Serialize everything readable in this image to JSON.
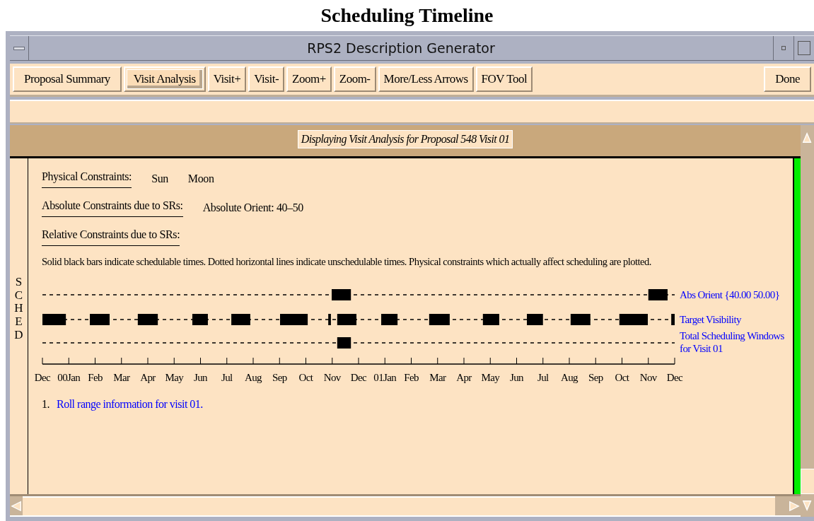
{
  "page_title": "Scheduling Timeline",
  "window": {
    "title": "RPS2 Description Generator"
  },
  "toolbar": {
    "buttons": [
      {
        "label": "Proposal Summary",
        "selected": false
      },
      {
        "label": "Visit Analysis",
        "selected": true
      },
      {
        "label": "Visit+",
        "selected": false
      },
      {
        "label": "Visit-",
        "selected": false
      },
      {
        "label": "Zoom+",
        "selected": false
      },
      {
        "label": "Zoom-",
        "selected": false
      },
      {
        "label": "More/Less Arrows",
        "selected": false
      },
      {
        "label": "FOV Tool",
        "selected": false
      }
    ],
    "done_button": "Done"
  },
  "banner": "Displaying Visit Analysis for Proposal 548 Visit 01",
  "side_label": "SCHED",
  "constraints": [
    {
      "label": "Physical Constraints:",
      "values": [
        "Sun",
        "Moon"
      ]
    },
    {
      "label": "Absolute Constraints due to SRs:",
      "values": [
        "Absolute Orient: 40–50"
      ]
    },
    {
      "label": "Relative Constraints due to SRs:"
    }
  ],
  "note": "Solid black bars indicate schedulable times. Dotted horizontal lines indicate unschedulable times.  Physical constraints which actually affect scheduling are plotted.",
  "timeline": {
    "rows": [
      "Abs Orient {40.00 50.00}",
      "Target Visibility",
      "Total Scheduling Windows for Visit 01"
    ],
    "months": [
      "Dec",
      "00Jan",
      "Feb",
      "Mar",
      "Apr",
      "May",
      "Jun",
      "Jul",
      "Aug",
      "Sep",
      "Oct",
      "Nov",
      "Dec",
      "01Jan",
      "Feb",
      "Mar",
      "Apr",
      "May",
      "Jun",
      "Jul",
      "Aug",
      "Sep",
      "Oct",
      "Nov",
      "Dec"
    ]
  },
  "footnotes": [
    {
      "number": "1.",
      "text": "Roll range information for visit 01."
    }
  ]
}
